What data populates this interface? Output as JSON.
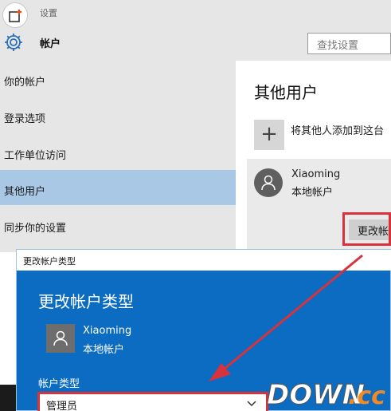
{
  "window": {
    "title": "设置",
    "section_title": "帐户",
    "search_placeholder": "查找设置"
  },
  "sidebar": {
    "items": [
      {
        "label": "你的帐户",
        "selected": false
      },
      {
        "label": "登录选项",
        "selected": false
      },
      {
        "label": "工作单位访问",
        "selected": false
      },
      {
        "label": "其他用户",
        "selected": true
      },
      {
        "label": "同步你的设置",
        "selected": false
      }
    ]
  },
  "main": {
    "title": "其他用户",
    "add_user_label": "将其他人添加到这台",
    "add_icon": "plus-icon",
    "user": {
      "name": "Xiaoming",
      "account_type": "本地帐户"
    },
    "change_button_label": "更改帐"
  },
  "dialog": {
    "window_title": "更改帐户类型",
    "heading": "更改帐户类型",
    "user": {
      "name": "Xiaoming",
      "account_type": "本地帐户"
    },
    "type_label": "帐户类型",
    "selected_type": "管理员"
  },
  "watermark": {
    "text_main": "DOWN",
    "text_suffix": ".cc"
  },
  "colors": {
    "accent_blue": "#0b6cc2",
    "selected_item": "#a8c8e6",
    "annotation_red": "#d8323c",
    "watermark_orange": "#f08a24"
  }
}
